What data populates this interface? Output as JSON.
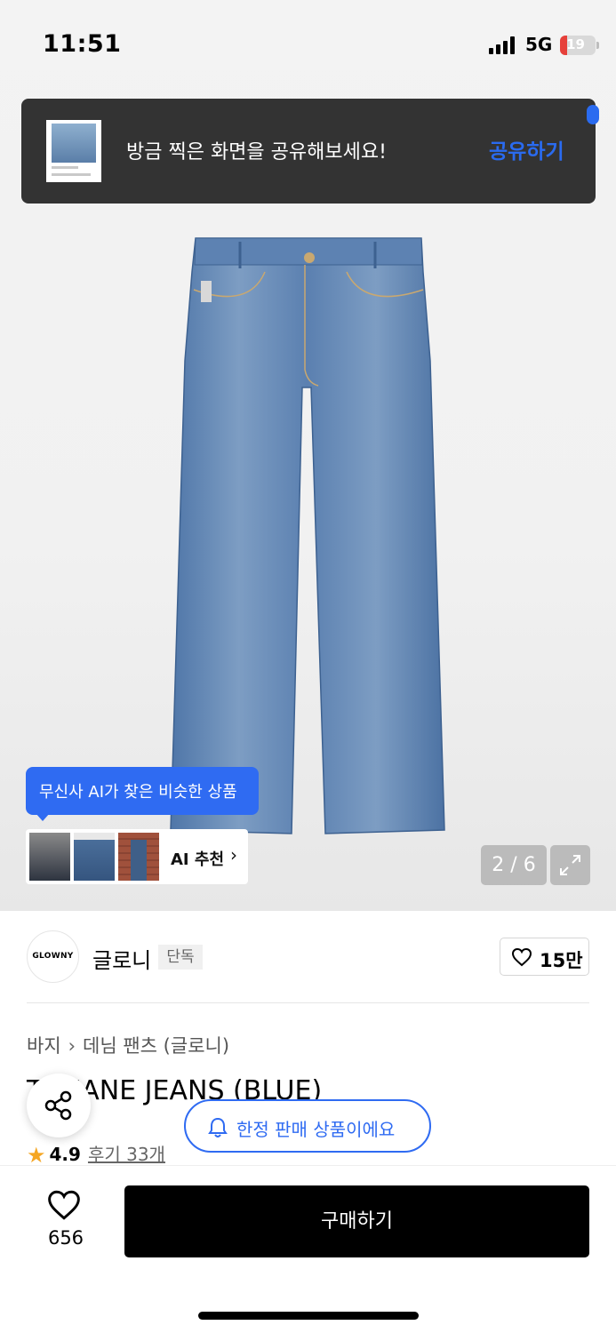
{
  "status_bar": {
    "time": "11:51",
    "network": "5G",
    "battery": "19"
  },
  "share_toast": {
    "message": "방금 찍은 화면을 공유해보세요!",
    "action": "공유하기"
  },
  "ai_similar": {
    "tooltip": "무신사 AI가 찾은 비슷한 상품",
    "label": "AI 추천"
  },
  "image_counter": "2 / 6",
  "brand": {
    "logo_text": "GLOWNY",
    "name": "글로니",
    "badge": "단독"
  },
  "brand_likes": "15만",
  "breadcrumb": [
    "바지",
    "데님 팬츠 (글로니)"
  ],
  "product": {
    "title": "T... JANE JEANS (BLUE)",
    "rating": "4.9",
    "reviews": "후기 33개"
  },
  "limited_banner": "한정 판매 상품이에요",
  "bottom": {
    "wish_count": "656",
    "buy_label": "구매하기"
  },
  "colors": {
    "accent": "#2f6bf2",
    "toast_bg": "#333333",
    "buy_bg": "#000000",
    "star": "#f5a623"
  }
}
